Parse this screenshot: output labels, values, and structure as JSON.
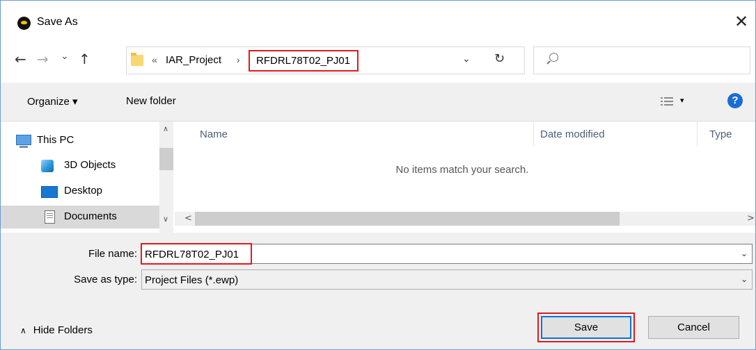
{
  "window": {
    "title": "Save As",
    "close_glyph": "✕",
    "app_icon": "app-icon"
  },
  "nav": {
    "back_glyph": "←",
    "forward_glyph": "→",
    "recent_glyph": "⌄",
    "up_glyph": "↑",
    "address": {
      "overflow_glyph": "«",
      "crumbs": [
        "IAR_Project",
        "RFDRL78T02_PJ01"
      ],
      "separator": "›",
      "dropdown_glyph": "⌄",
      "refresh_glyph": "↻"
    },
    "search": {
      "placeholder": ""
    }
  },
  "toolbar": {
    "organize_label": "Organize ▾",
    "new_folder_label": "New folder",
    "view_chevron": "▾",
    "help_label": "?"
  },
  "sidebar": {
    "items": [
      {
        "label": "This PC",
        "icon": "this-pc-icon"
      },
      {
        "label": "3D Objects",
        "icon": "3d-objects-icon"
      },
      {
        "label": "Desktop",
        "icon": "desktop-icon"
      },
      {
        "label": "Documents",
        "icon": "documents-icon",
        "selected": true
      }
    ],
    "scroll_up": "∧",
    "scroll_down": "∨"
  },
  "file_list": {
    "columns": [
      "Name",
      "Date modified",
      "Type"
    ],
    "empty_message": "No items match your search.",
    "scroll_left": "<",
    "scroll_right": ">"
  },
  "form": {
    "file_name_label": "File name:",
    "file_name_value": "RFDRL78T02_PJ01",
    "save_type_label": "Save as type:",
    "save_type_value": "Project Files (*.ewp)",
    "dropdown_glyph": "⌄"
  },
  "footer": {
    "hide_folders_caret": "∧",
    "hide_folders_label": "Hide Folders",
    "save_label": "Save",
    "cancel_label": "Cancel"
  },
  "colors": {
    "highlight": "#e0191e",
    "accent": "#0078d7",
    "selection": "#d9d9d9"
  }
}
